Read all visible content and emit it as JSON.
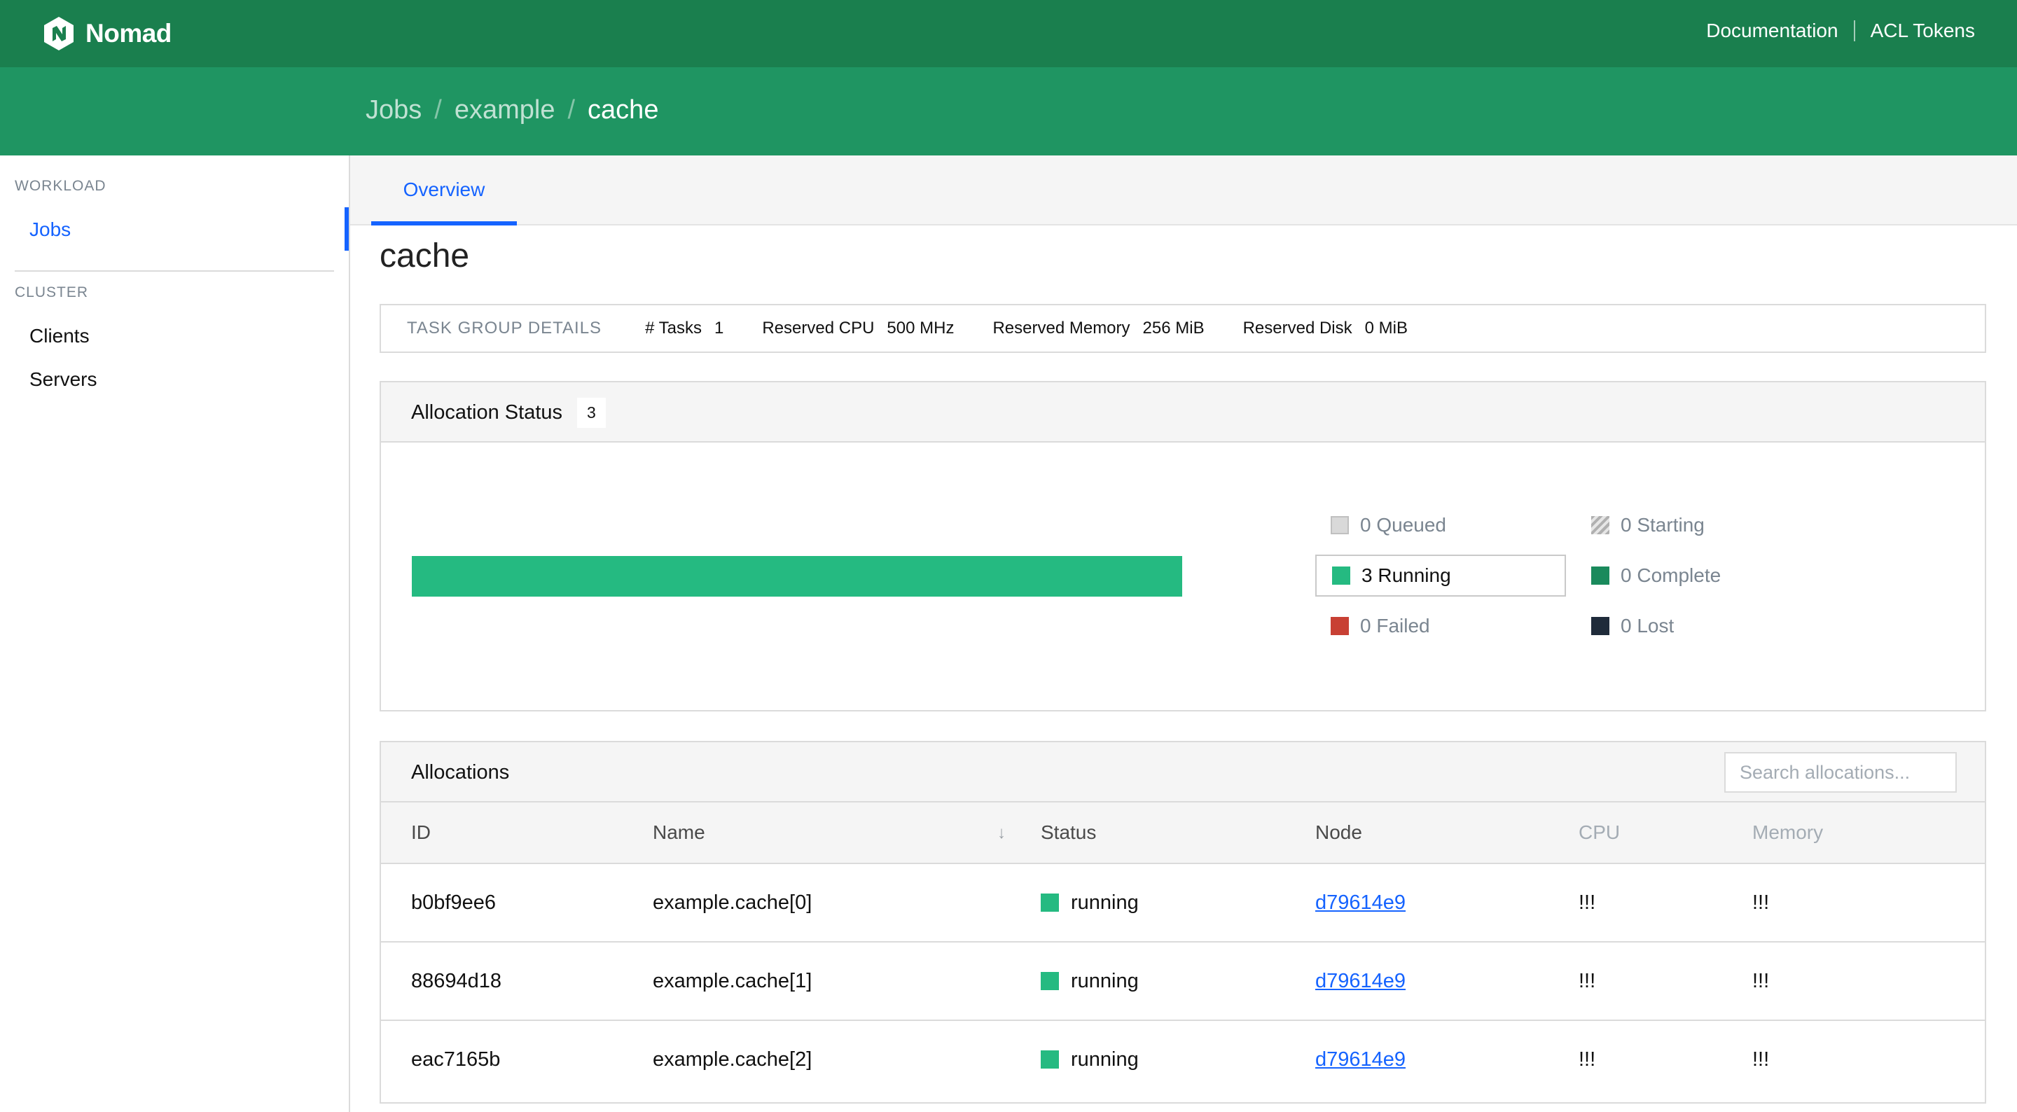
{
  "app": {
    "name": "Nomad"
  },
  "top_nav": {
    "documentation": "Documentation",
    "acl_tokens": "ACL Tokens"
  },
  "breadcrumbs": [
    {
      "label": "Jobs"
    },
    {
      "label": "example"
    },
    {
      "label": "cache"
    }
  ],
  "breadcrumb_separator": "/",
  "sidebar": {
    "workload_label": "WORKLOAD",
    "jobs": "Jobs",
    "cluster_label": "CLUSTER",
    "clients": "Clients",
    "servers": "Servers"
  },
  "tabs": {
    "overview": "Overview"
  },
  "page_title": "cache",
  "task_group_details": {
    "heading": "TASK GROUP DETAILS",
    "tasks_label": "# Tasks",
    "tasks_value": "1",
    "cpu_label": "Reserved CPU",
    "cpu_value": "500 MHz",
    "memory_label": "Reserved Memory",
    "memory_value": "256 MiB",
    "disk_label": "Reserved Disk",
    "disk_value": "0 MiB"
  },
  "allocation_status": {
    "title": "Allocation Status",
    "count": "3",
    "running_fraction": 1.0,
    "legend": {
      "queued": "0 Queued",
      "starting": "0 Starting",
      "running": "3 Running",
      "complete": "0 Complete",
      "failed": "0 Failed",
      "lost": "0 Lost"
    },
    "colors": {
      "queued": "#d9d9d9",
      "running": "#25ba81",
      "complete": "#1a8a5c",
      "failed": "#c84034",
      "lost": "#1f2b3a"
    }
  },
  "allocations": {
    "title": "Allocations",
    "search_placeholder": "Search allocations...",
    "columns": {
      "id": "ID",
      "name": "Name",
      "status": "Status",
      "node": "Node",
      "cpu": "CPU",
      "memory": "Memory"
    },
    "rows": [
      {
        "id": "b0bf9ee6",
        "name": "example.cache[0]",
        "status": "running",
        "node": "d79614e9",
        "cpu": "!!!",
        "memory": "!!!"
      },
      {
        "id": "88694d18",
        "name": "example.cache[1]",
        "status": "running",
        "node": "d79614e9",
        "cpu": "!!!",
        "memory": "!!!"
      },
      {
        "id": "eac7165b",
        "name": "example.cache[2]",
        "status": "running",
        "node": "d79614e9",
        "cpu": "!!!",
        "memory": "!!!"
      }
    ]
  }
}
